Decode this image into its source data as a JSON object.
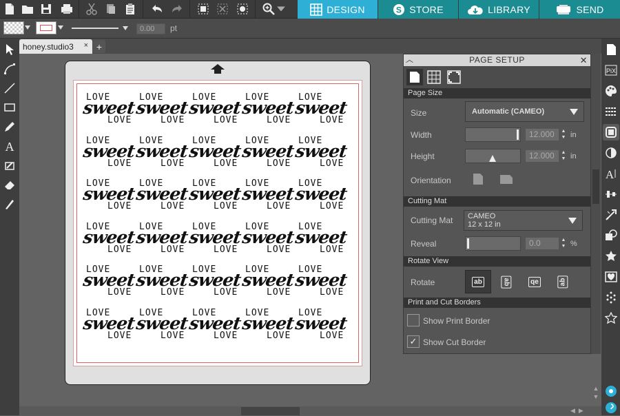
{
  "toolbar": {
    "icons": [
      "new-file-icon",
      "open-folder-icon",
      "save-icon",
      "print-icon",
      "cut-icon",
      "copy-icon",
      "paste-icon",
      "undo-icon",
      "redo-icon",
      "group-icon",
      "ungroup-icon",
      "select-all-icon",
      "zoom-icon"
    ]
  },
  "nav": {
    "tabs": [
      {
        "label": "DESIGN",
        "active": true
      },
      {
        "label": "STORE",
        "active": false
      },
      {
        "label": "LIBRARY",
        "active": false
      },
      {
        "label": "SEND",
        "active": false
      }
    ]
  },
  "options": {
    "line_width_value": "0.00",
    "line_width_unit": "pt"
  },
  "document": {
    "tab_label": "honey.studio3",
    "close_glyph": "×",
    "add_glyph": "+"
  },
  "design": {
    "line1": "LOVE",
    "script": "sweet",
    "line2": "LOVE",
    "rows": 6,
    "cols": 5
  },
  "panel": {
    "title": "PAGE SETUP",
    "page_size": {
      "header": "Page Size",
      "size_label": "Size",
      "size_value": "Automatic (CAMEO)",
      "width_label": "Width",
      "width_value": "12.000",
      "width_unit": "in",
      "height_label": "Height",
      "height_value": "12.000",
      "height_unit": "in",
      "orientation_label": "Orientation"
    },
    "cutting_mat": {
      "header": "Cutting Mat",
      "mat_label": "Cutting Mat",
      "mat_value_line1": "CAMEO",
      "mat_value_line2": "12 x 12 in",
      "reveal_label": "Reveal",
      "reveal_value": "0.0",
      "reveal_unit": "%"
    },
    "rotate_view": {
      "header": "Rotate View",
      "rotate_label": "Rotate",
      "options": [
        "ab",
        "ab",
        "qe",
        "ab"
      ]
    },
    "borders": {
      "header": "Print and Cut Borders",
      "show_print_border": "Show Print Border",
      "show_print_checked": false,
      "show_cut_border": "Show Cut Border",
      "show_cut_checked": true
    }
  },
  "colors": {
    "active_tab": "#2dafd6",
    "inactive_tab": "#1b8c91",
    "cut_border": "#e06060"
  }
}
